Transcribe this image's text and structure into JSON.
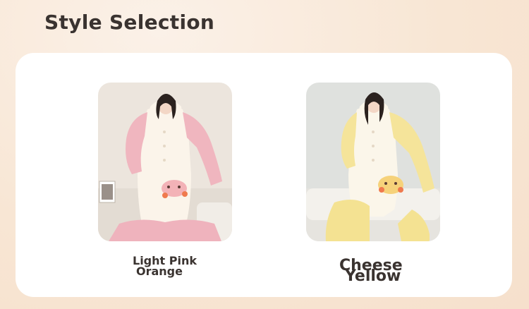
{
  "page": {
    "title": "Style Selection"
  },
  "options": [
    {
      "id": "light-pink-orange",
      "label_line1": "Light Pink",
      "label_line2": "Orange",
      "accent_color": "#f2b8c2"
    },
    {
      "id": "cheese-yellow",
      "label_line1": "Cheese",
      "label_line2": "Yellow",
      "accent_color": "#f6e6a0"
    }
  ]
}
